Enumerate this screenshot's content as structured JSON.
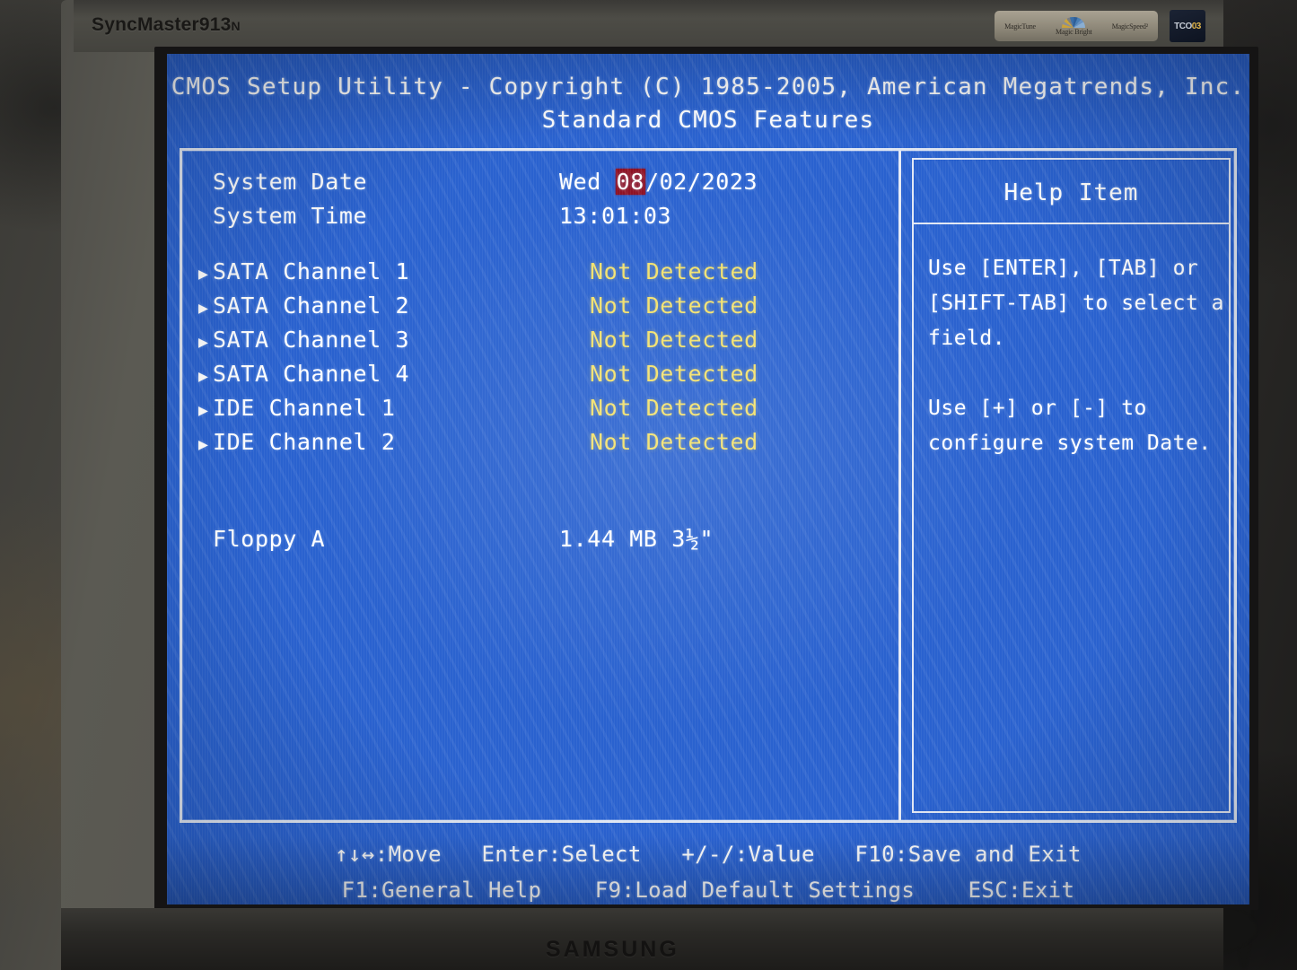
{
  "hardware": {
    "monitor_brand_top": "SyncMaster",
    "monitor_model_top": "913",
    "monitor_model_suffix": "N",
    "monitor_brand_bottom": "SAMSUNG",
    "stickers": {
      "magictune": "MagicTune",
      "magicbright": "Magic Bright",
      "magicspeed": "MagicSpeed²",
      "tco_label": "TCO",
      "tco_year": "03"
    }
  },
  "bios": {
    "title": "CMOS Setup Utility - Copyright (C) 1985-2005, American Megatrends, Inc.",
    "subtitle": "Standard CMOS Features",
    "screen_bg": "#2a62cf",
    "text_color": "#ffffff",
    "value_color": "#f2e06a",
    "highlight_color": "#8d1023",
    "date": {
      "label": "System Date",
      "weekday": "Wed",
      "month": "08",
      "sep1": "/",
      "day": "02",
      "sep2": "/",
      "year": "2023"
    },
    "time": {
      "label": "System Time",
      "value": "13:01:03"
    },
    "channels": [
      {
        "marker": "▶",
        "label": "SATA Channel 1",
        "value": "Not Detected"
      },
      {
        "marker": "▶",
        "label": "SATA Channel 2",
        "value": "Not Detected"
      },
      {
        "marker": "▶",
        "label": "SATA Channel 3",
        "value": "Not Detected"
      },
      {
        "marker": "▶",
        "label": "SATA Channel 4",
        "value": "Not Detected"
      },
      {
        "marker": "▶",
        "label": "IDE Channel 1",
        "value": "Not Detected"
      },
      {
        "marker": "▶",
        "label": "IDE Channel 2",
        "value": "Not Detected"
      }
    ],
    "floppy": {
      "label": "Floppy A",
      "value": "1.44 MB 3½\""
    },
    "help": {
      "title": "Help Item",
      "paragraph1": "Use [ENTER], [TAB] or [SHIFT-TAB] to select a field.",
      "paragraph2": "Use [+] or [-] to configure system Date."
    },
    "footer": {
      "line1": [
        "↑↓↔:Move",
        "Enter:Select",
        "+/-/:Value",
        "F10:Save and Exit"
      ],
      "line2": [
        "F1:General Help",
        "F9:Load Default Settings",
        "ESC:Exit"
      ]
    }
  }
}
